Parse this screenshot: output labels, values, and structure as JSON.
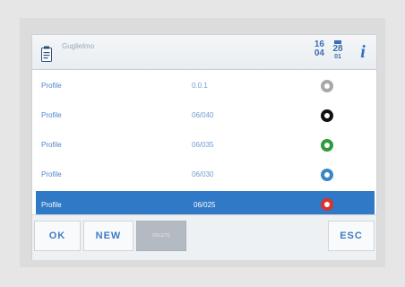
{
  "header": {
    "title": "Guglielmo",
    "time_hour": "16",
    "time_minute": "04",
    "date_day": "28",
    "date_month": "01"
  },
  "rows": [
    {
      "label": "Profile",
      "value": "0.0.1",
      "ring_color": "#a8a8a8",
      "selected": false
    },
    {
      "label": "Profile",
      "value": "06/040",
      "ring_color": "#111111",
      "selected": false
    },
    {
      "label": "Profile",
      "value": "06/035",
      "ring_color": "#2e9b3c",
      "selected": false
    },
    {
      "label": "Profile",
      "value": "06/030",
      "ring_color": "#3a85c9",
      "selected": false
    },
    {
      "label": "Profile",
      "value": "06/025",
      "ring_color": "#d8332c",
      "selected": true
    }
  ],
  "buttons": {
    "ok": "OK",
    "new": "NEW",
    "delete": "DELETE",
    "esc": "ESC"
  },
  "colors": {
    "accent": "#2f79c7",
    "text_blue": "#3f7cc4"
  }
}
